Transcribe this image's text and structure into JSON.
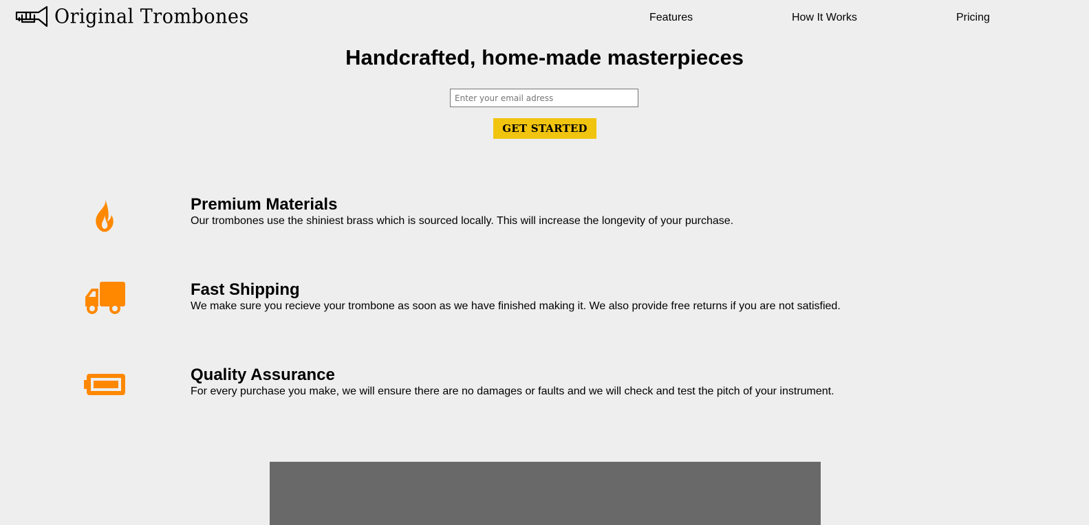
{
  "brand": {
    "name": "Original Trombones",
    "logo_icon": "trombone-icon"
  },
  "nav": {
    "items": [
      {
        "label": "Features"
      },
      {
        "label": "How It Works"
      },
      {
        "label": "Pricing"
      }
    ]
  },
  "hero": {
    "title": "Handcrafted, home-made masterpieces",
    "email_placeholder": "Enter your email adress",
    "email_value": "",
    "cta_label": "GET STARTED"
  },
  "features": [
    {
      "icon": "fire-icon",
      "title": "Premium Materials",
      "description": "Our trombones use the shiniest brass which is sourced locally. This will increase the longevity of your purchase."
    },
    {
      "icon": "truck-icon",
      "title": "Fast Shipping",
      "description": "We make sure you recieve your trombone as soon as we have finished making it. We also provide free returns if you are not satisfied."
    },
    {
      "icon": "battery-icon",
      "title": "Quality Assurance",
      "description": "For every purchase you make, we will ensure there are no damages or faults and we will check and test the pitch of your instrument."
    }
  ],
  "colors": {
    "background": "#eeeeee",
    "accent_button": "#f1c40f",
    "icon_orange": "#ff8800",
    "video_placeholder": "#696969"
  }
}
